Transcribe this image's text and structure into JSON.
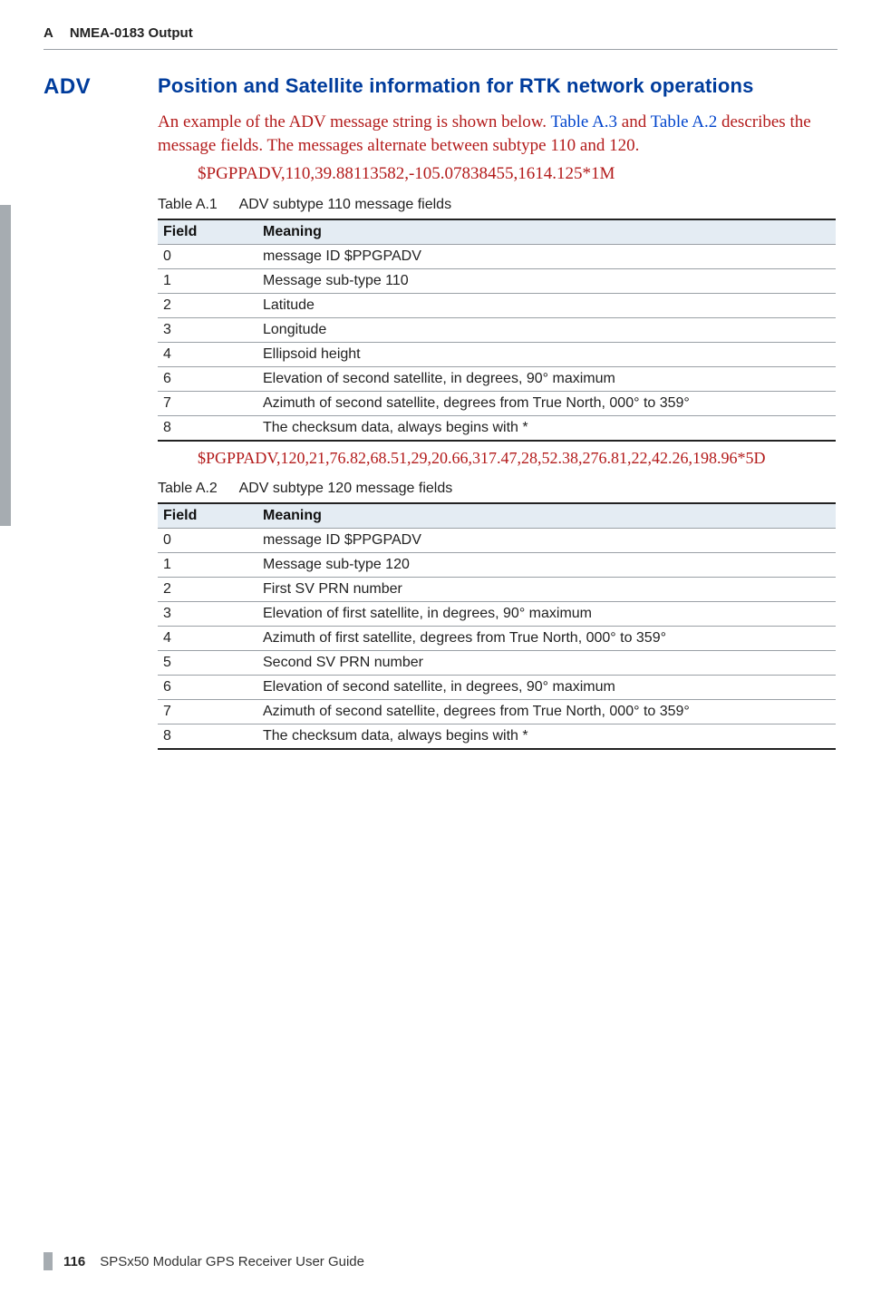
{
  "header": {
    "chapter_letter": "A",
    "chapter_title": "NMEA-0183 Output"
  },
  "side_label": "ADV",
  "section_title": "Position and Satellite information for RTK network operations",
  "intro": {
    "pre": "An example of the ADV message string is shown below. ",
    "link1": "Table A.3",
    "and": " and ",
    "link2": "Table A.2",
    "post": " describes the message fields. The messages alternate between subtype 110 and 120."
  },
  "sample1": "$PGPPADV,110,39.88113582,-105.07838455,1614.125*1M",
  "table1": {
    "caption_num": "Table A.1",
    "caption_text": "ADV subtype 110 message fields",
    "cols": [
      "Field",
      "Meaning"
    ],
    "rows": [
      [
        "0",
        "message ID $PPGPADV"
      ],
      [
        "1",
        "Message sub-type 110"
      ],
      [
        "2",
        "Latitude"
      ],
      [
        "3",
        "Longitude"
      ],
      [
        "4",
        "Ellipsoid height"
      ],
      [
        "6",
        "Elevation of second satellite, in degrees, 90° maximum"
      ],
      [
        "7",
        "Azimuth of second satellite, degrees from True North, 000° to 359°"
      ],
      [
        "8",
        "The checksum data, always begins with *"
      ]
    ]
  },
  "sample2": "$PGPPADV,120,21,76.82,68.51,29,20.66,317.47,28,52.38,276.81,22,42.26,198.96*5D",
  "table2": {
    "caption_num": "Table A.2",
    "caption_text": "ADV subtype 120 message fields",
    "cols": [
      "Field",
      "Meaning"
    ],
    "rows": [
      [
        "0",
        "message ID $PPGPADV"
      ],
      [
        "1",
        "Message sub-type 120"
      ],
      [
        "2",
        "First SV PRN number"
      ],
      [
        "3",
        "Elevation of first satellite, in degrees, 90° maximum"
      ],
      [
        "4",
        "Azimuth of first satellite, degrees from True North, 000° to 359°"
      ],
      [
        "5",
        "Second SV PRN number"
      ],
      [
        "6",
        "Elevation of second satellite, in degrees, 90° maximum"
      ],
      [
        "7",
        "Azimuth of second satellite, degrees from True North, 000° to 359°"
      ],
      [
        "8",
        "The checksum data, always begins with *"
      ]
    ]
  },
  "footer": {
    "page_number": "116",
    "pub_title": "SPSx50 Modular GPS Receiver User Guide"
  }
}
